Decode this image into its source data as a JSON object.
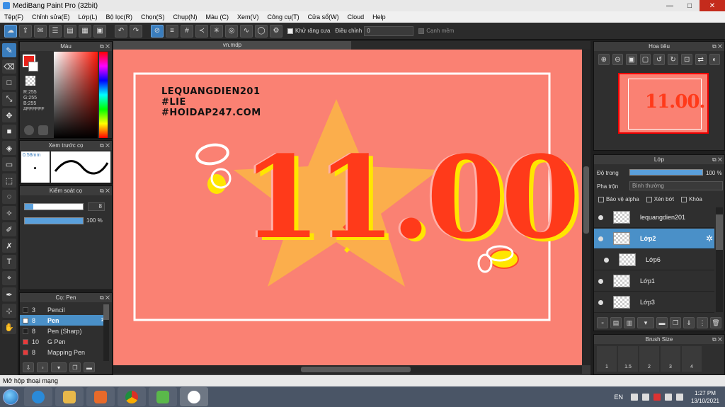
{
  "window": {
    "title": "MediBang Paint Pro (32bit)",
    "min": "—",
    "max": "□",
    "close": "✕"
  },
  "menu": [
    "Tệp(F)",
    "Chỉnh sửa(E)",
    "Lớp(L)",
    "Bộ lọc(R)",
    "Chọn(S)",
    "Chụp(N)",
    "Màu (C)",
    "Xem(V)",
    "Công cụ(T)",
    "Cửa sổ(W)",
    "Cloud",
    "Help"
  ],
  "toolbar": {
    "antialias_label": "Khử răng cưa",
    "adjust_label": "Điều chỉnh",
    "adjust_value": "0",
    "edge_label": "Cạnh mềm"
  },
  "color_panel": {
    "title": "Màu",
    "rgb_r": "R:255",
    "rgb_g": "G:255",
    "rgb_b": "B:255",
    "hex": "#FFFFFF"
  },
  "preview_panel": {
    "title": "Xem trước cọ",
    "size": "0.58mm"
  },
  "brush_control": {
    "title": "Kiểm soát cọ",
    "size_value": "8",
    "opacity_value": "100 %"
  },
  "brush_list": {
    "title": "Cọ: Pen",
    "items": [
      {
        "size": "3",
        "name": "Pencil",
        "color": "#222222"
      },
      {
        "size": "8",
        "name": "Pen",
        "color": "#ffffff"
      },
      {
        "size": "8",
        "name": "Pen (Sharp)",
        "color": "#222222"
      },
      {
        "size": "10",
        "name": "G Pen",
        "color": "#e83a3a"
      },
      {
        "size": "8",
        "name": "Mapping Pen",
        "color": "#e83a3a"
      }
    ]
  },
  "document": {
    "tab": "vn.mdp"
  },
  "artwork": {
    "line1": "LEQUANGDIEN201",
    "line2": "#LIE",
    "line3": "#HOIDAP247.COM",
    "big_text": "11.00."
  },
  "navigator": {
    "title": "Hoa tiêu"
  },
  "layers_panel": {
    "title": "Lớp",
    "opacity_label": "Độ trong",
    "opacity_value": "100 %",
    "blend_label": "Pha trộn",
    "blend_value": "Bình thường",
    "protect_alpha": "Bảo vệ alpha",
    "clip": "Xén bớt",
    "lock": "Khóa",
    "layers": [
      "lequangdien201",
      "Lớp2",
      "Lớp6",
      "Lớp1",
      "Lớp3"
    ]
  },
  "brush_size": {
    "title": "Brush Size",
    "sizes": [
      "1",
      "1.5",
      "2",
      "3",
      "4"
    ]
  },
  "status": {
    "text": "Mở hộp thoại mạng"
  },
  "tray": {
    "lang": "EN",
    "time": "1:27 PM",
    "date": "13/10/2021"
  }
}
